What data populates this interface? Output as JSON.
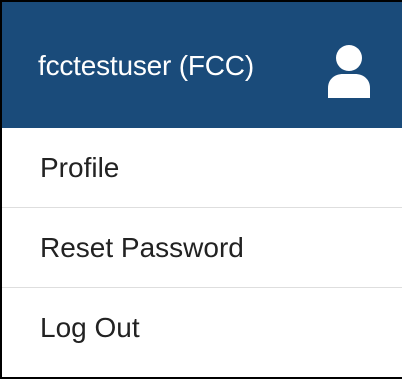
{
  "header": {
    "username": "fcctestuser (FCC)",
    "icon": "user-icon",
    "background_color": "#1a4b7a",
    "text_color": "#ffffff"
  },
  "menu": {
    "items": [
      {
        "label": "Profile"
      },
      {
        "label": "Reset Password"
      },
      {
        "label": "Log Out"
      }
    ]
  }
}
